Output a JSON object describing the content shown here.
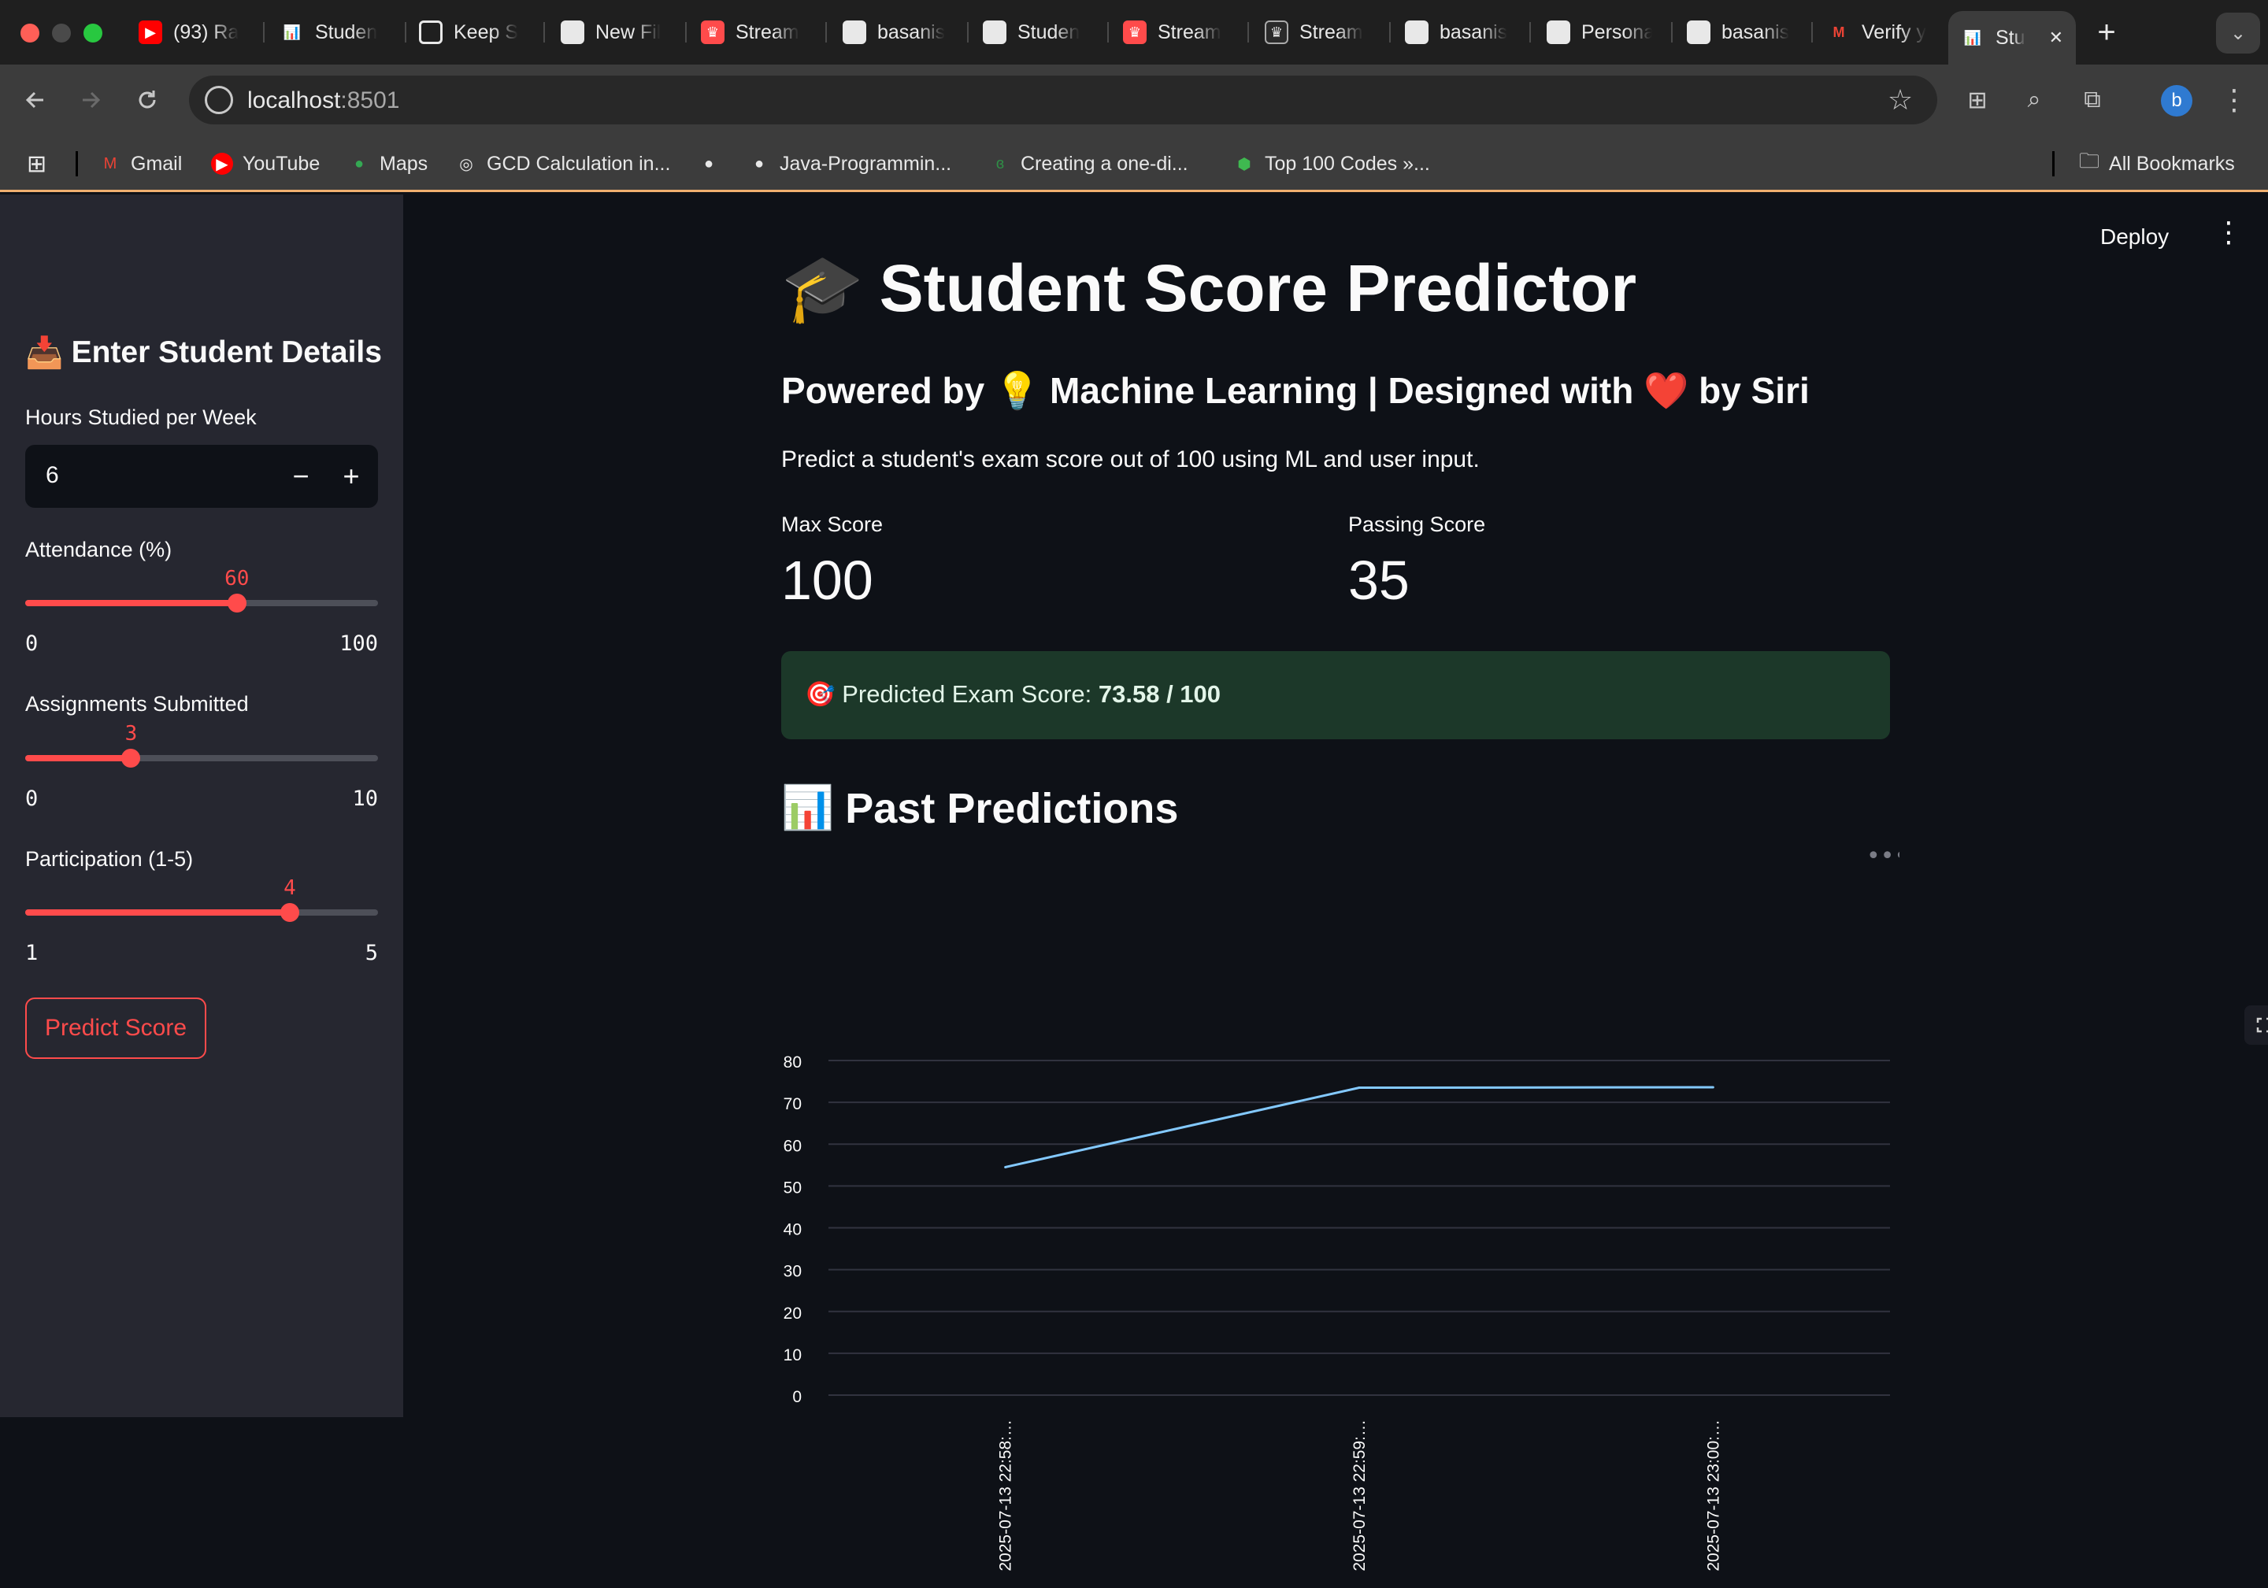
{
  "browser": {
    "tabs": [
      {
        "title": "(93) Ra",
        "favicon": "youtube-icon"
      },
      {
        "title": "Studen",
        "favicon": "bar-chart-icon"
      },
      {
        "title": "Keep S",
        "favicon": "openai-icon"
      },
      {
        "title": "New Fil",
        "favicon": "github-icon"
      },
      {
        "title": "Stream",
        "favicon": "streamlit-icon"
      },
      {
        "title": "basanis",
        "favicon": "github-icon"
      },
      {
        "title": "Studen",
        "favicon": "github-icon"
      },
      {
        "title": "Stream",
        "favicon": "streamlit-icon"
      },
      {
        "title": "Stream",
        "favicon": "streamlit-dark-icon"
      },
      {
        "title": "basanis",
        "favicon": "github-icon"
      },
      {
        "title": "Persona",
        "favicon": "github-icon"
      },
      {
        "title": "basanis",
        "favicon": "github-icon"
      },
      {
        "title": "Verify y",
        "favicon": "gmail-icon"
      },
      {
        "title": "Stu",
        "favicon": "bar-chart-icon",
        "active": true
      }
    ],
    "url_host": "localhost",
    "url_port": ":8501",
    "profile_initial": "b",
    "bookmarks": [
      {
        "label": "Gmail",
        "icon": "gmail-icon"
      },
      {
        "label": "YouTube",
        "icon": "youtube-icon"
      },
      {
        "label": "Maps",
        "icon": "maps-pin-icon"
      },
      {
        "label": "GCD Calculation in...",
        "icon": "openai-icon"
      },
      {
        "label": "",
        "icon": "globe-icon"
      },
      {
        "label": "Java-Programmin...",
        "icon": "github-icon"
      },
      {
        "label": "Creating a one-di...",
        "icon": "geeksforgeeks-icon"
      },
      {
        "label": "Top 100 Codes »...",
        "icon": "shield-icon"
      }
    ],
    "all_bookmarks_label": "All Bookmarks"
  },
  "sidebar": {
    "heading": "Enter Student Details",
    "heading_icon": "inbox-tray-icon",
    "hours": {
      "label": "Hours Studied per Week",
      "value": "6",
      "minus": "−",
      "plus": "+"
    },
    "attendance": {
      "label": "Attendance (%)",
      "value": "60",
      "min": "0",
      "max": "100",
      "fraction": 0.6
    },
    "assignments": {
      "label": "Assignments Submitted",
      "value": "3",
      "min": "0",
      "max": "10",
      "fraction": 0.3
    },
    "participation": {
      "label": "Participation (1-5)",
      "value": "4",
      "min": "1",
      "max": "5",
      "fraction": 0.75
    },
    "predict_button": "Predict Score"
  },
  "header": {
    "deploy": "Deploy"
  },
  "main": {
    "title": "Student Score Predictor",
    "title_icon": "graduation-cap-icon",
    "subtitle": "Powered by 💡 Machine Learning | Designed with ❤️ by Siri",
    "description": "Predict a student's exam score out of 100 using ML and user input.",
    "metrics": [
      {
        "label": "Max Score",
        "value": "100"
      },
      {
        "label": "Passing Score",
        "value": "35"
      }
    ],
    "result_prefix": "Predicted Exam Score: ",
    "result_value": "73.58 / 100",
    "result_icon": "target-icon",
    "past_title": "Past Predictions",
    "past_icon": "bar-chart-icon"
  },
  "chart_data": {
    "type": "line",
    "x": [
      "2025-07-13 22:58:…",
      "2025-07-13 22:59:…",
      "2025-07-13 23:00:…"
    ],
    "series": [
      {
        "values": [
          54.5,
          73.5,
          73.6
        ]
      }
    ],
    "ylim": [
      0,
      80
    ],
    "yticks": [
      0,
      10,
      20,
      30,
      40,
      50,
      60,
      70,
      80
    ],
    "grid": true,
    "line_color": "#83c9ff"
  }
}
